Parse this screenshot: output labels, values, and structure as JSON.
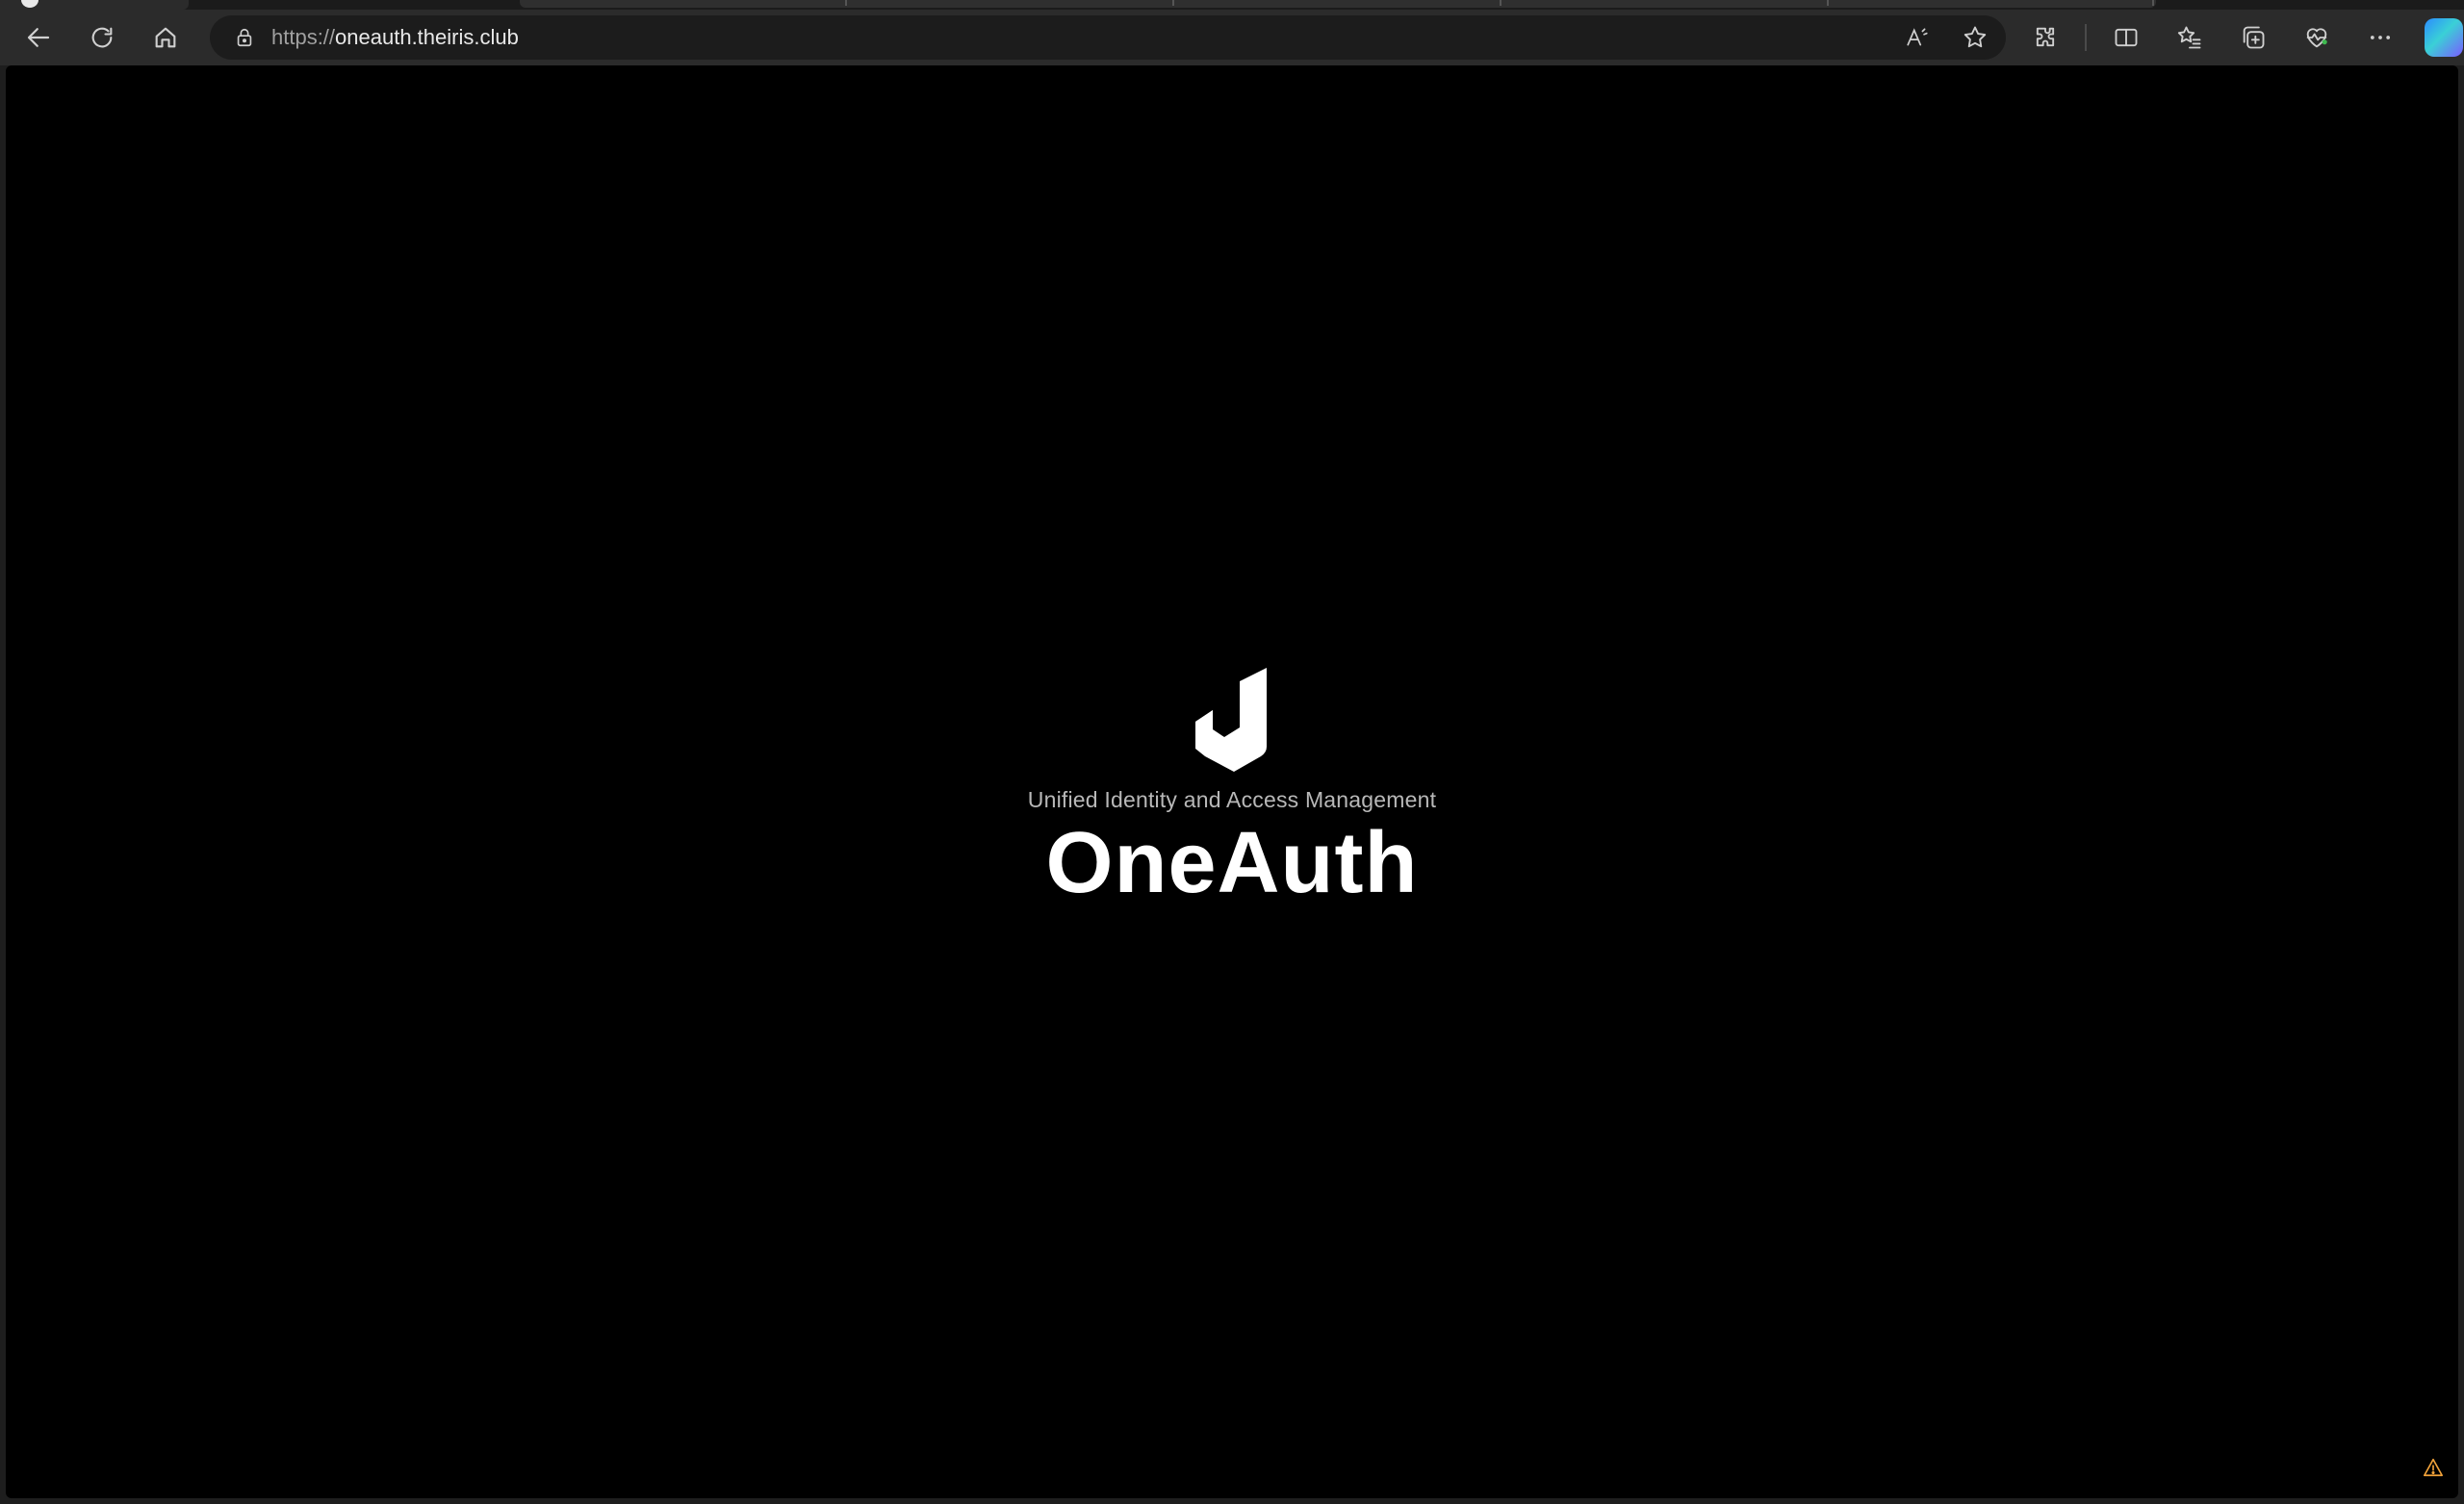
{
  "browser": {
    "url_scheme": "https://",
    "url_host": "oneauth.theiris.club",
    "icons": {
      "back": "back-arrow-icon",
      "refresh": "refresh-icon",
      "home": "home-icon",
      "lock": "lock-icon",
      "read_aloud": "read-aloud-icon",
      "favorite": "star-icon",
      "extensions": "puzzle-icon",
      "split_screen": "split-screen-icon",
      "favorites": "favorites-list-icon",
      "collections": "collections-icon",
      "performance": "heart-pulse-icon",
      "more": "more-dots-icon",
      "copilot": "copilot-icon"
    }
  },
  "page": {
    "tagline": "Unified Identity and Access Management",
    "brand": "OneAuth",
    "logo": "oneauth-logo",
    "warning": "warning-icon",
    "colors": {
      "background": "#000000",
      "brand_text": "#ffffff",
      "tagline_text": "#b8b8b8",
      "warning": "#f2a33a"
    }
  }
}
